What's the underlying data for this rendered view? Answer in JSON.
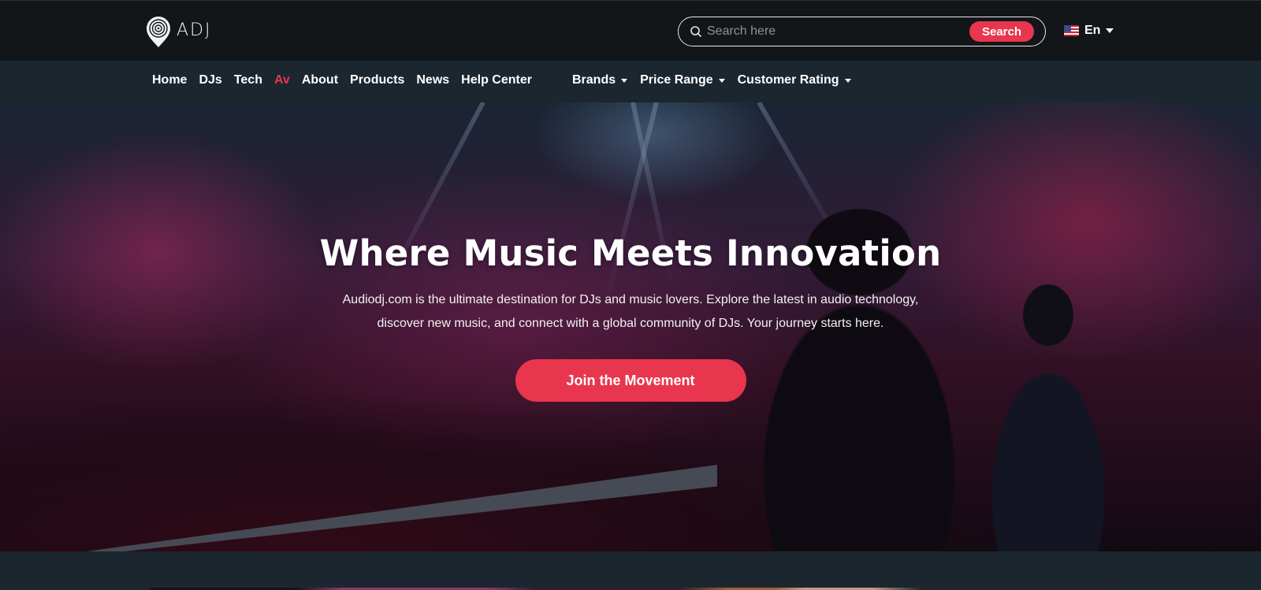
{
  "header": {
    "logo_text": "ADJ",
    "search": {
      "placeholder": "Search here",
      "button_label": "Search"
    },
    "language": {
      "label": "En"
    }
  },
  "nav": {
    "links": [
      "Home",
      "DJs",
      "Tech",
      "Av",
      "About",
      "Products",
      "News",
      "Help Center"
    ],
    "active": "Av",
    "dropdowns": [
      "Brands",
      "Price Range",
      "Customer Rating"
    ]
  },
  "hero": {
    "title": "Where Music Meets Innovation",
    "description": "Audiodj.com is the ultimate destination for DJs and music lovers. Explore the latest in audio technology, discover new music, and connect with a global community of DJs. Your journey starts here.",
    "cta_label": "Join the Movement"
  },
  "colors": {
    "accent": "#e8364e",
    "header_bg": "#121619",
    "nav_bg": "#1c262e"
  }
}
